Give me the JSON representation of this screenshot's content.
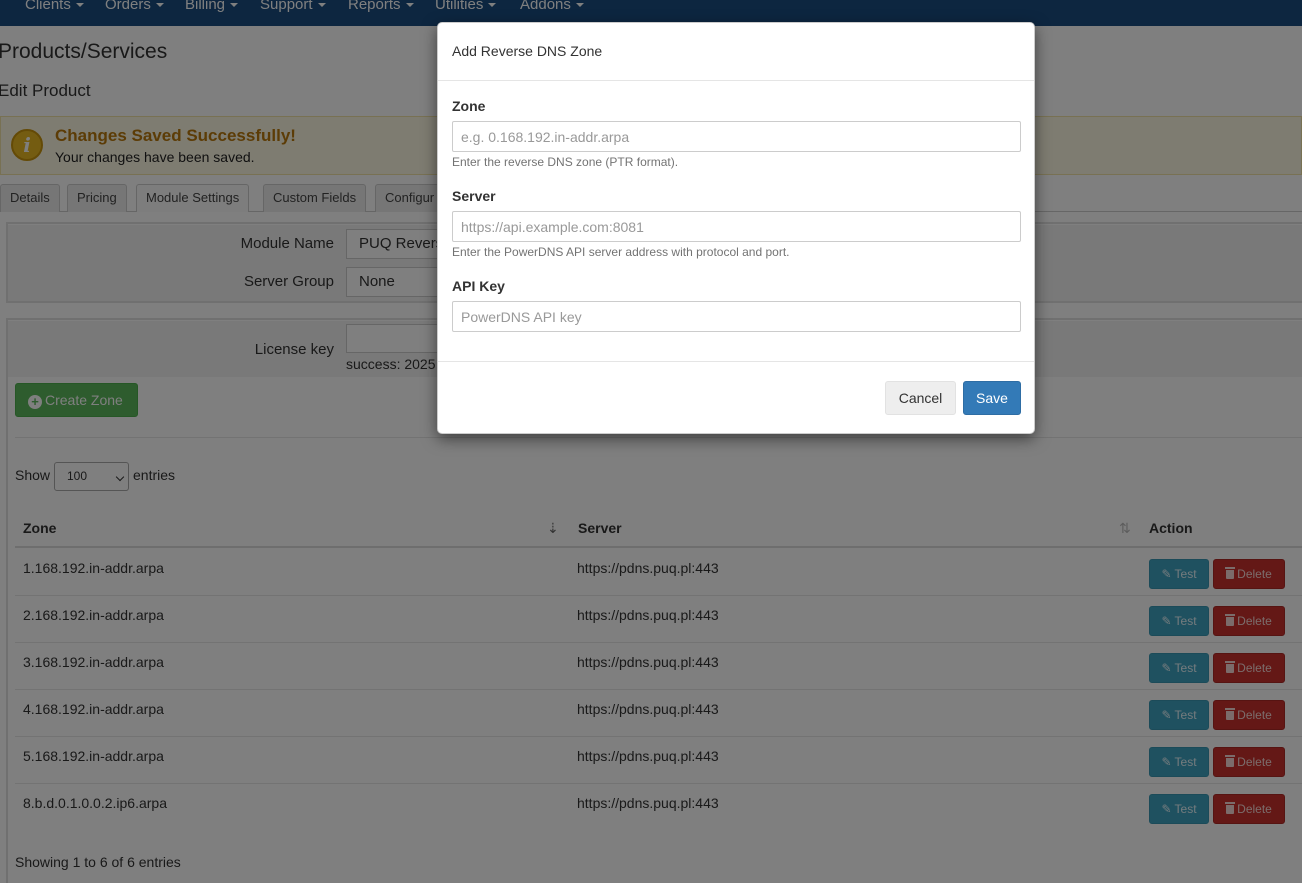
{
  "nav": {
    "items": [
      "Clients",
      "Orders",
      "Billing",
      "Support",
      "Reports",
      "Utilities",
      "Addons"
    ]
  },
  "page": {
    "title": "Products/Services",
    "subtitle": "Edit Product"
  },
  "alert": {
    "title": "Changes Saved Successfully!",
    "text": "Your changes have been saved.",
    "icon": "info-icon"
  },
  "tabs": [
    "Details",
    "Pricing",
    "Module Settings",
    "Custom Fields",
    "Configur"
  ],
  "module": {
    "module_name_label": "Module Name",
    "module_name_value": "PUQ Revers",
    "server_group_label": "Server Group",
    "server_group_value": "None",
    "license_label": "License key",
    "license_status": "success: 2025"
  },
  "create_zone_label": "Create Zone",
  "table": {
    "show_label": "Show",
    "page_size": "100",
    "entries_label": "entries",
    "headers": {
      "zone": "Zone",
      "server": "Server",
      "action": "Action"
    },
    "rows": [
      {
        "zone": "1.168.192.in-addr.arpa",
        "server": "https://pdns.puq.pl:443"
      },
      {
        "zone": "2.168.192.in-addr.arpa",
        "server": "https://pdns.puq.pl:443"
      },
      {
        "zone": "3.168.192.in-addr.arpa",
        "server": "https://pdns.puq.pl:443"
      },
      {
        "zone": "4.168.192.in-addr.arpa",
        "server": "https://pdns.puq.pl:443"
      },
      {
        "zone": "5.168.192.in-addr.arpa",
        "server": "https://pdns.puq.pl:443"
      },
      {
        "zone": "8.b.d.0.1.0.0.2.ip6.arpa",
        "server": "https://pdns.puq.pl:443"
      }
    ],
    "test_label": "Test",
    "delete_label": "Delete",
    "footer": "Showing 1 to 6 of 6 entries"
  },
  "modal": {
    "title": "Add Reverse DNS Zone",
    "zone_label": "Zone",
    "zone_placeholder": "e.g. 0.168.192.in-addr.arpa",
    "zone_help": "Enter the reverse DNS zone (PTR format).",
    "server_label": "Server",
    "server_placeholder": "https://api.example.com:8081",
    "server_help": "Enter the PowerDNS API server address with protocol and port.",
    "apikey_label": "API Key",
    "apikey_placeholder": "PowerDNS API key",
    "cancel_label": "Cancel",
    "save_label": "Save"
  },
  "colors": {
    "nav_bg": "#1a4d80",
    "alert_bg": "#fcf8e3",
    "create_btn": "#5cb85c",
    "test_btn": "#3fa3c1",
    "delete_btn": "#c9302c",
    "save_btn": "#337ab7"
  }
}
